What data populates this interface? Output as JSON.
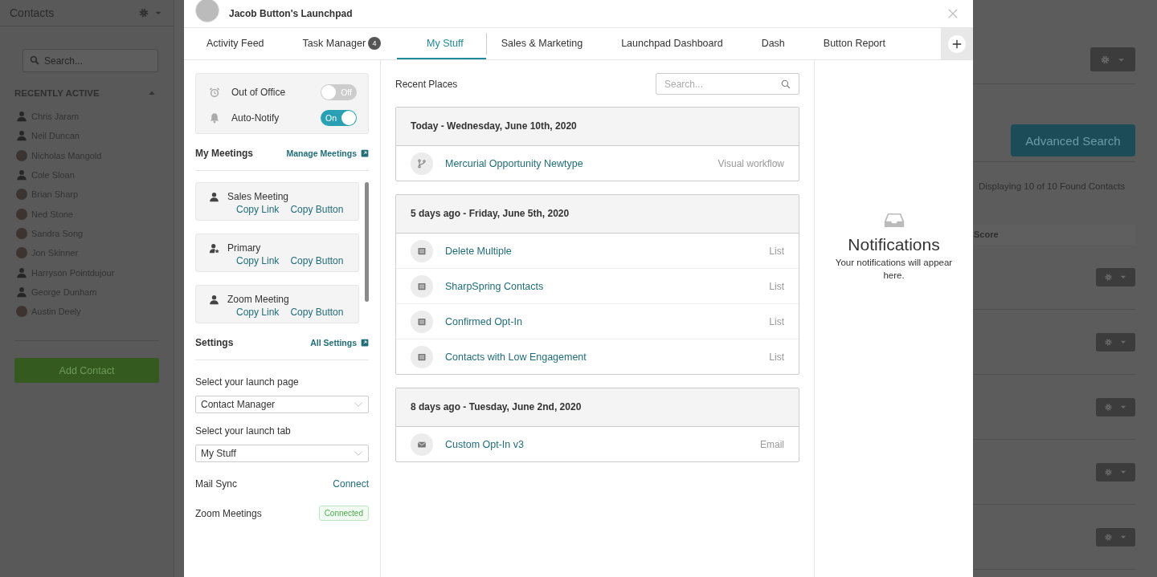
{
  "background": {
    "sidebar": {
      "title": "Contacts",
      "search": {
        "placeholder": "Search..."
      },
      "section_title": "RECENTLY ACTIVE",
      "expanded": true,
      "contacts": [
        {
          "name": "Chris Jaram",
          "kind": "silhouette"
        },
        {
          "name": "Neil Duncan",
          "kind": "silhouette"
        },
        {
          "name": "Nicholas Mangold",
          "kind": "photo"
        },
        {
          "name": "Cole Sloan",
          "kind": "silhouette"
        },
        {
          "name": "Brian Sharp",
          "kind": "photo"
        },
        {
          "name": "Ned Stone",
          "kind": "photo"
        },
        {
          "name": "Sandra Song",
          "kind": "photo"
        },
        {
          "name": "Jon Skinner",
          "kind": "photo"
        },
        {
          "name": "Harryson Pointdujour",
          "kind": "silhouette"
        },
        {
          "name": "George Dunham",
          "kind": "silhouette"
        },
        {
          "name": "Austin Deely",
          "kind": "photo"
        }
      ],
      "add_button": "Add Contact"
    },
    "main": {
      "advanced_search": "Advanced Search",
      "result_count": "Displaying 10 of 10 Found Contacts",
      "column_header": "Score"
    }
  },
  "dialog": {
    "title": "Jacob Button's Launchpad",
    "tabs": [
      {
        "label": "Activity Feed",
        "selected": false
      },
      {
        "label": "Task Manager",
        "badge": "4",
        "selected": false
      },
      {
        "label": "My Stuff",
        "selected": true,
        "divider_after": true
      },
      {
        "label": "Sales & Marketing",
        "selected": false
      },
      {
        "label": "Launchpad Dashboard",
        "selected": false
      },
      {
        "label": "Dash",
        "selected": false
      },
      {
        "label": "Button Report",
        "selected": false
      }
    ],
    "toggles": [
      {
        "label": "Out of Office",
        "kind": "alarm",
        "on": false,
        "state_text": "Off"
      },
      {
        "label": "Auto-Notify",
        "kind": "bell",
        "on": true,
        "state_text": "On"
      }
    ],
    "meetings": {
      "title": "My Meetings",
      "link": "Manage Meetings",
      "items": [
        {
          "name": "Sales Meeting",
          "kind": "person",
          "actions": [
            "Copy Link",
            "Copy Button"
          ]
        },
        {
          "name": "Primary",
          "kind": "person-star",
          "actions": [
            "Copy Link",
            "Copy Button"
          ]
        },
        {
          "name": "Zoom Meeting",
          "kind": "person",
          "actions": [
            "Copy Link",
            "Copy Button"
          ]
        }
      ]
    },
    "settings": {
      "title": "Settings",
      "link": "All Settings",
      "selects": [
        {
          "label": "Select your launch page",
          "value": "Contact Manager"
        },
        {
          "label": "Select your launch tab",
          "value": "My Stuff"
        }
      ],
      "integrations": [
        {
          "label": "Mail Sync",
          "kind": "link",
          "value": "Connect"
        },
        {
          "label": "Zoom Meetings",
          "kind": "badge",
          "value": "Connected"
        }
      ]
    },
    "recent_places": {
      "title": "Recent Places",
      "search": {
        "placeholder": "Search..."
      },
      "groups": [
        {
          "heading": "Today - Wednesday, June 10th, 2020",
          "items": [
            {
              "name": "Mercurial Opportunity Newtype",
              "type": "Visual workflow",
              "kind": "workflow"
            }
          ]
        },
        {
          "heading": "5 days ago - Friday, June 5th, 2020",
          "items": [
            {
              "name": "Delete Multiple",
              "type": "List",
              "kind": "list"
            },
            {
              "name": "SharpSpring Contacts",
              "type": "List",
              "kind": "list"
            },
            {
              "name": "Confirmed Opt-In",
              "type": "List",
              "kind": "list"
            },
            {
              "name": "Contacts with Low Engagement",
              "type": "List",
              "kind": "list"
            }
          ]
        },
        {
          "heading": "8 days ago - Tuesday, June 2nd, 2020",
          "items": [
            {
              "name": "Custom Opt-In v3",
              "type": "Email",
              "kind": "email"
            }
          ]
        }
      ]
    },
    "notifications": {
      "title": "Notifications",
      "message": "Your notifications will appear here."
    }
  }
}
